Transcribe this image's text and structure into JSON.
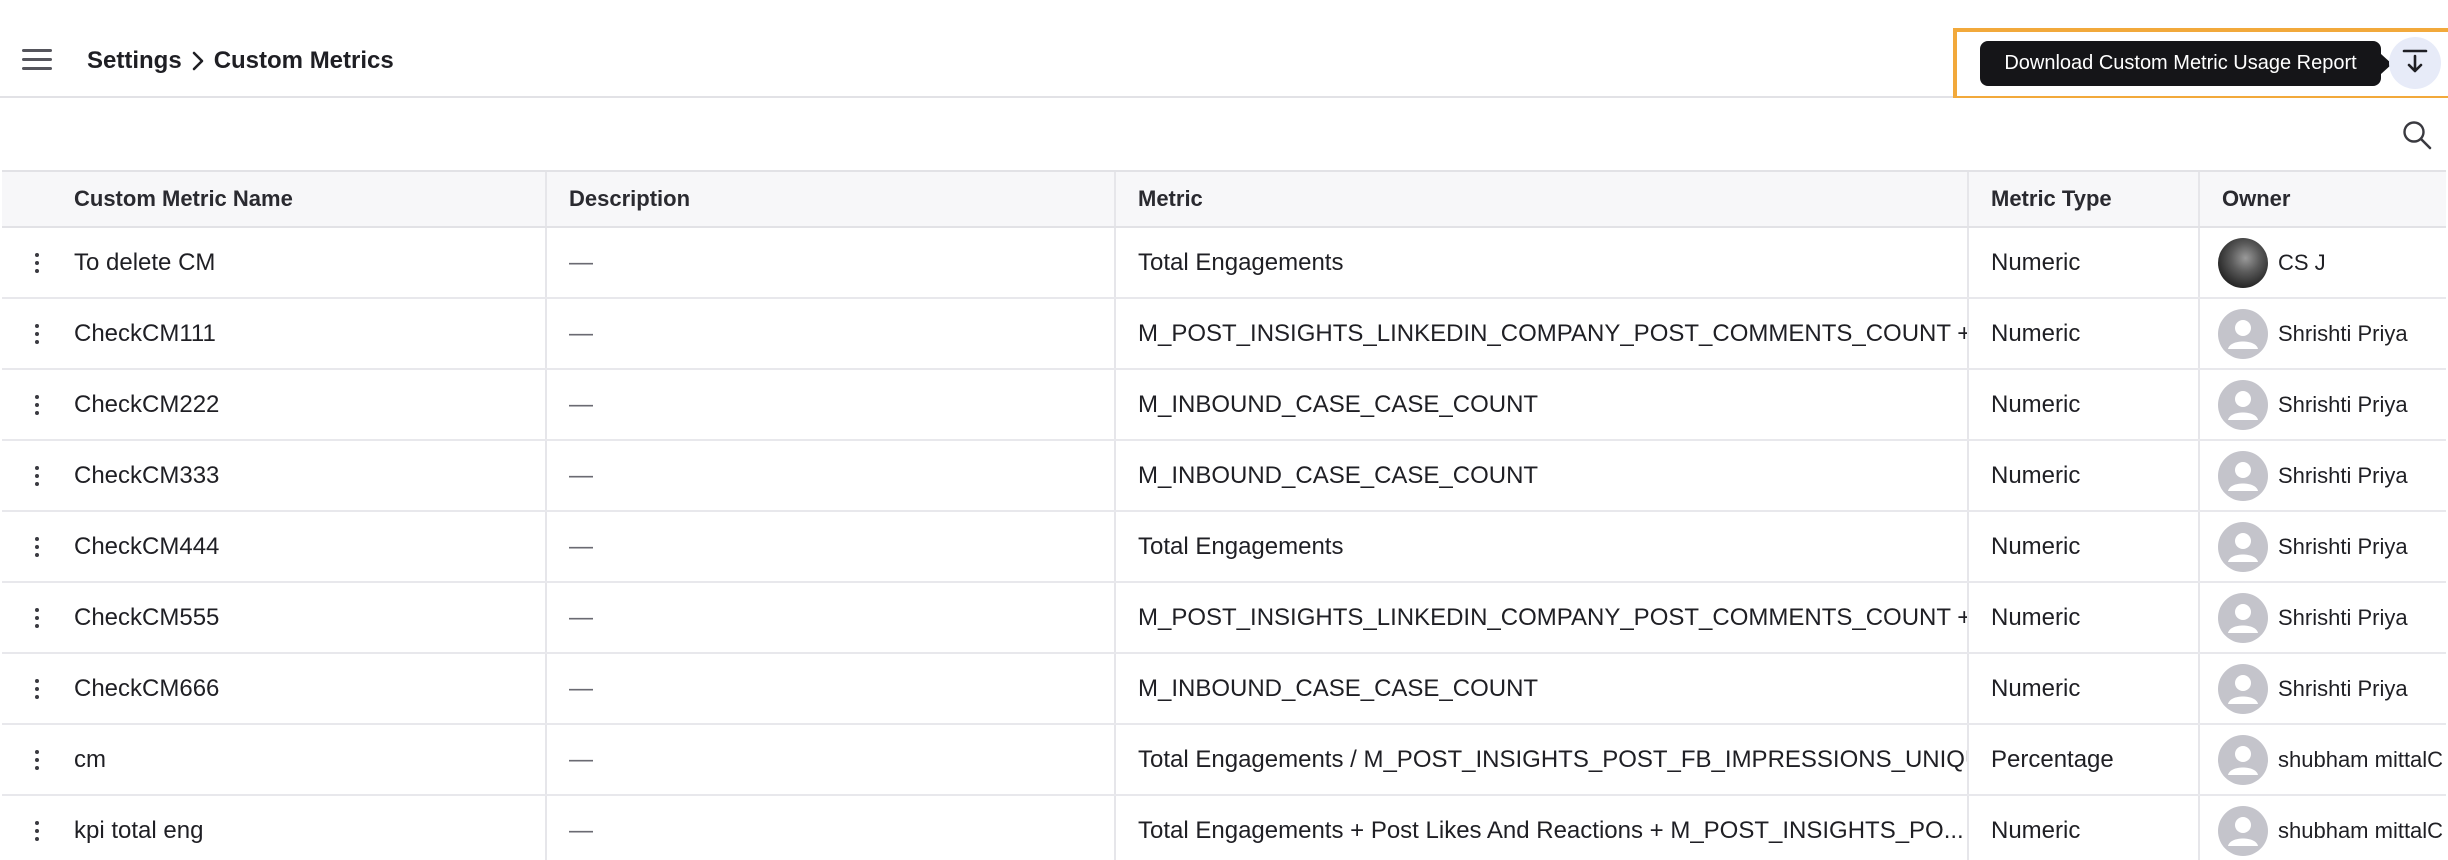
{
  "header": {
    "breadcrumb": [
      "Settings",
      "Custom Metrics"
    ],
    "tooltip": "Download Custom Metric Usage Report",
    "accent_color": "#f2a93b"
  },
  "icons": {
    "menu": "hamburger-menu-icon",
    "separator": "chevron-right-icon",
    "download": "download-report-icon",
    "search": "search-icon",
    "row_actions": "kebab-menu-icon",
    "avatar": "user-avatar-icon"
  },
  "table": {
    "columns": [
      "Custom Metric Name",
      "Description",
      "Metric",
      "Metric Type",
      "Owner"
    ],
    "rows": [
      {
        "name": "To delete CM",
        "description": "—",
        "metric": "Total Engagements",
        "type": "Numeric",
        "owner": "CS J",
        "avatar": "photo"
      },
      {
        "name": "CheckCM111",
        "description": "—",
        "metric": "M_POST_INSIGHTS_LINKEDIN_COMPANY_POST_COMMENTS_COUNT + ...",
        "type": "Numeric",
        "owner": "Shrishti Priya",
        "avatar": "generic"
      },
      {
        "name": "CheckCM222",
        "description": "—",
        "metric": "M_INBOUND_CASE_CASE_COUNT",
        "type": "Numeric",
        "owner": "Shrishti Priya",
        "avatar": "generic"
      },
      {
        "name": "CheckCM333",
        "description": "—",
        "metric": "M_INBOUND_CASE_CASE_COUNT",
        "type": "Numeric",
        "owner": "Shrishti Priya",
        "avatar": "generic"
      },
      {
        "name": "CheckCM444",
        "description": "—",
        "metric": "Total Engagements",
        "type": "Numeric",
        "owner": "Shrishti Priya",
        "avatar": "generic"
      },
      {
        "name": "CheckCM555",
        "description": "—",
        "metric": "M_POST_INSIGHTS_LINKEDIN_COMPANY_POST_COMMENTS_COUNT + ...",
        "type": "Numeric",
        "owner": "Shrishti Priya",
        "avatar": "generic"
      },
      {
        "name": "CheckCM666",
        "description": "—",
        "metric": "M_INBOUND_CASE_CASE_COUNT",
        "type": "Numeric",
        "owner": "Shrishti Priya",
        "avatar": "generic"
      },
      {
        "name": "cm",
        "description": "—",
        "metric": "Total Engagements / M_POST_INSIGHTS_POST_FB_IMPRESSIONS_UNIQUE",
        "type": "Percentage",
        "owner": "shubham mittalC",
        "avatar": "generic"
      },
      {
        "name": "kpi total eng",
        "description": "—",
        "metric": "Total Engagements + Post Likes And Reactions + M_POST_INSIGHTS_PO...",
        "type": "Numeric",
        "owner": "shubham mittalC",
        "avatar": "generic"
      }
    ]
  }
}
